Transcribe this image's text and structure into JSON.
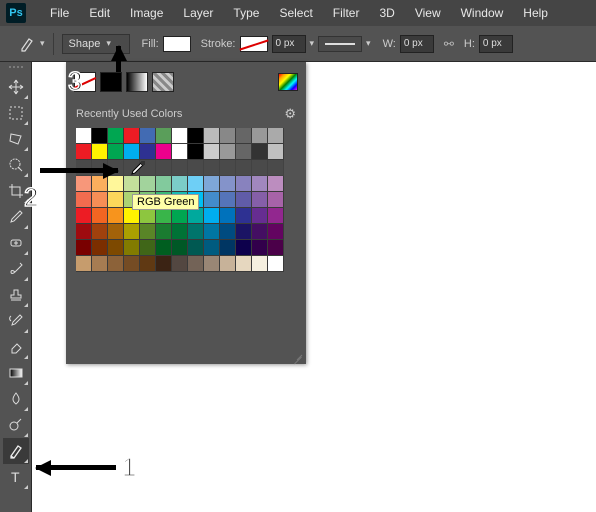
{
  "menu": {
    "items": [
      "File",
      "Edit",
      "Image",
      "Layer",
      "Type",
      "Select",
      "Filter",
      "3D",
      "View",
      "Window",
      "Help"
    ]
  },
  "options": {
    "mode_label": "Shape",
    "fill_label": "Fill:",
    "stroke_label": "Stroke:",
    "stroke_width": "0 px",
    "w_label": "W:",
    "w_value": "0 px",
    "h_label": "H:",
    "h_value": "0 px"
  },
  "swatches": {
    "recent_label": "Recently Used Colors",
    "tooltip": "RGB Green",
    "recent_colors": [
      "#ffffff",
      "#000000",
      "#00a651",
      "#ed1c24",
      "#426bb3",
      "#5a9e5a",
      "#ffffff",
      "#000000",
      "#bbbbbb",
      "#888888",
      "#666666",
      "#999999",
      "#aaaaaa"
    ],
    "row_active": [
      "#ed1c24",
      "#fff200",
      "#00a651",
      "#00aeef",
      "#2e3192",
      "#ec008c",
      "#ffffff",
      "#000000",
      "#cccccc",
      "#999999",
      "#666666",
      "#333333",
      "#c0c0c0"
    ],
    "blank_rows": 1,
    "main_rows": [
      [
        "#f7977a",
        "#fbaf5d",
        "#fff79a",
        "#c4df9b",
        "#a2d39c",
        "#82ca9d",
        "#7bcdc8",
        "#6ecff6",
        "#7ea7d8",
        "#8493ca",
        "#8882be",
        "#a187be",
        "#bc8dbf"
      ],
      [
        "#f26c4f",
        "#f68e56",
        "#fbd75b",
        "#acd373",
        "#7cc576",
        "#3bb878",
        "#1abbb4",
        "#00bff3",
        "#438ccb",
        "#5574b9",
        "#605ca8",
        "#855fa8",
        "#a763a8"
      ],
      [
        "#ed1c24",
        "#f26522",
        "#f7941d",
        "#fff200",
        "#8dc63f",
        "#39b54a",
        "#00a651",
        "#00a99d",
        "#00aeef",
        "#0072bc",
        "#2e3192",
        "#662d91",
        "#92278f"
      ],
      [
        "#9e0b0f",
        "#a0410d",
        "#a36209",
        "#aba000",
        "#598527",
        "#1a7b30",
        "#007236",
        "#00746b",
        "#0076a3",
        "#004b80",
        "#1b1464",
        "#440e62",
        "#630460"
      ],
      [
        "#790000",
        "#7b2e00",
        "#7d4900",
        "#827b00",
        "#406618",
        "#005e20",
        "#005826",
        "#005952",
        "#005b7f",
        "#003663",
        "#0d004c",
        "#32004b",
        "#4b0049"
      ],
      [
        "#c69c6d",
        "#a67c52",
        "#8c6239",
        "#754c24",
        "#603913",
        "#3b2314",
        "#534741",
        "#736357",
        "#998675",
        "#c7b299",
        "#e6d7bf",
        "#f5efdf",
        "#ffffff"
      ]
    ]
  },
  "callouts": {
    "c1": "1",
    "c2": "2",
    "c3": "3"
  }
}
